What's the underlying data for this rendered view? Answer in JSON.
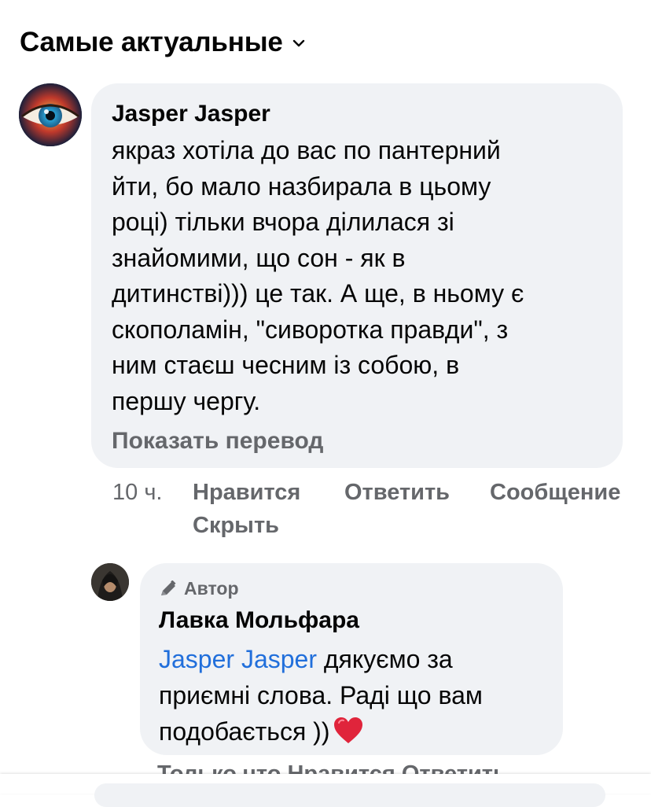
{
  "header": {
    "sort_label": "Самые актуальные"
  },
  "comments": [
    {
      "author": "Jasper Jasper",
      "text": "якраз хотіла до вас по пантерний\nйти, бо мало назбирала в цьому\nроці) тільки вчора ділилася зі\nзнайомими, що сон - як в\nдитинстві))) це так. А ще, в ньому є\nскополамін, \"сиворотка правди\", з\nним стаєш чесним із собою, в\nпершу чергу.",
      "translate_label": "Показать перевод",
      "time": "10 ч.",
      "actions": {
        "like": "Нравится",
        "reply": "Ответить",
        "message": "Сообщение",
        "hide": "Скрыть"
      }
    }
  ],
  "reply": {
    "badge": "Автор",
    "author": "Лавка Мольфара",
    "mention": "Jasper Jasper",
    "text_line1": " дякуємо за",
    "text_rest": "приємні слова. Раді що вам\nподобається ))",
    "partial_row": "Только что     Нравится     Ответить"
  },
  "colors": {
    "bubble": "#f0f2f5",
    "meta": "#65676b",
    "mention": "#216fdb",
    "heart": "#e0243b"
  },
  "icons": {
    "chevron": "chevron-down-icon",
    "badge": "pencil-icon",
    "heart": "heart-emoji-icon"
  }
}
